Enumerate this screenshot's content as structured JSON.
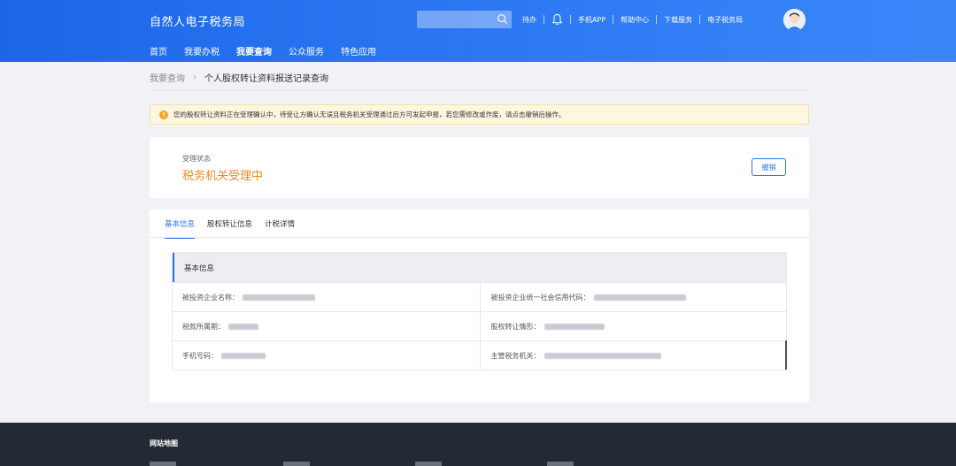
{
  "header": {
    "brand": "自然人电子税务局",
    "search_placeholder": "",
    "links": {
      "todo": "待办",
      "app": "手机APP",
      "help": "帮助中心",
      "download": "下载服务",
      "etax": "电子税务局"
    },
    "nav": [
      "首页",
      "我要办税",
      "我要查询",
      "公众服务",
      "特色应用"
    ]
  },
  "breadcrumb": {
    "root": "我要查询",
    "current": "个人股权转让资料报送记录查询"
  },
  "notice": {
    "text": "您的股权转让资料正在受理确认中，待受让方确认无误且税务机关受理通过后方可发起申报，若您需修改或作废，请点击撤销后操作。"
  },
  "status": {
    "label": "受理状态",
    "value": "税务机关受理中",
    "revoke_button": "撤销"
  },
  "tabs": [
    "基本信息",
    "股权转让信息",
    "计税详情"
  ],
  "basic_info": {
    "title": "基本信息",
    "rows": [
      [
        {
          "label": "被投资企业名称：",
          "value": ""
        },
        {
          "label": "被投资企业统一社会信用代码：",
          "value": ""
        }
      ],
      [
        {
          "label": "税款所属期：",
          "value": ""
        },
        {
          "label": "股权转让情形：",
          "value": ""
        }
      ],
      [
        {
          "label": "手机号码：",
          "value": ""
        },
        {
          "label": "主管税务机关：",
          "value": ""
        }
      ]
    ]
  },
  "footer": {
    "title": "网站地图"
  },
  "colors": {
    "header_blue": "#2a73f0",
    "status_orange": "#f08a24",
    "footer_dark": "#242a33"
  }
}
